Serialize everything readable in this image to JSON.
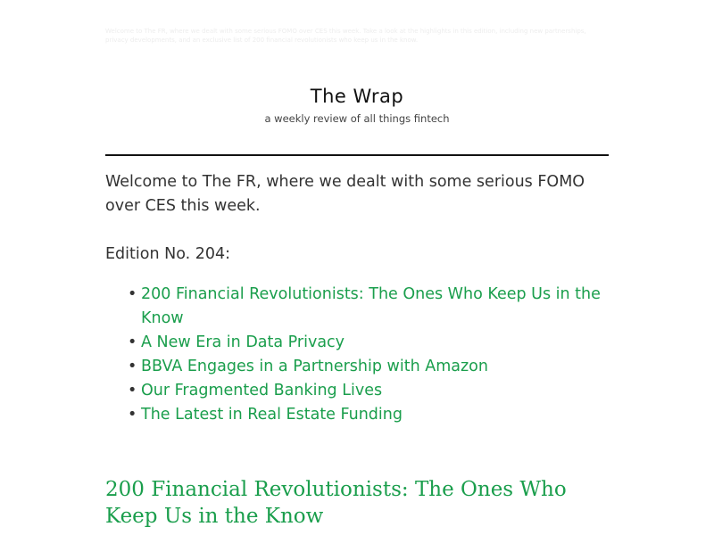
{
  "preheader": {
    "text": "Welcome to The FR, where we dealt with some serious FOMO over CES this week. Take a look at the highlights in this edition, including new partnerships, privacy developments, and an exclusive list of 200 financial revolutionists who keep us in the know."
  },
  "masthead": {
    "title": "The Wrap",
    "tagline": "a weekly review of all things fintech"
  },
  "intro": {
    "text": "Welcome to The FR, where we dealt with some serious FOMO over CES this week."
  },
  "edition": {
    "label": "Edition No. 204:"
  },
  "toc": {
    "items": [
      {
        "label": "200 Financial Revolutionists: The Ones Who Keep Us in the Know"
      },
      {
        "label": "A New Era in Data Privacy"
      },
      {
        "label": "BBVA Engages in a Partnership with Amazon"
      },
      {
        "label": "Our Fragmented Banking Lives"
      },
      {
        "label": "The Latest in Real Estate Funding"
      }
    ]
  },
  "section": {
    "heading": "200 Financial Revolutionists: The Ones Who Keep Us in the Know"
  },
  "colors": {
    "link": "#1a9e4c",
    "text": "#333333",
    "rule": "#111111"
  }
}
